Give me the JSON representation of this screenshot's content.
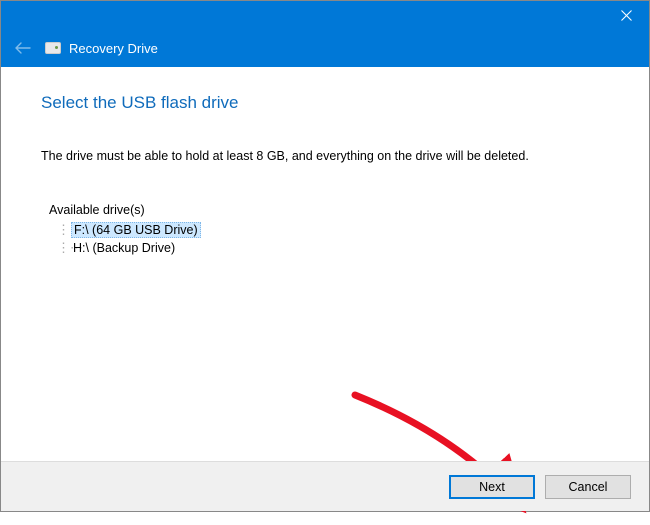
{
  "window": {
    "title": "Recovery Drive"
  },
  "page": {
    "heading": "Select the USB flash drive",
    "description": "The drive must be able to hold at least 8 GB, and everything on the drive will be deleted."
  },
  "tree": {
    "root_label": "Available drive(s)",
    "items": [
      {
        "label": "F:\\ (64 GB USB Drive)",
        "selected": true
      },
      {
        "label": "H:\\ (Backup Drive)",
        "selected": false
      }
    ]
  },
  "buttons": {
    "next": "Next",
    "cancel": "Cancel"
  }
}
